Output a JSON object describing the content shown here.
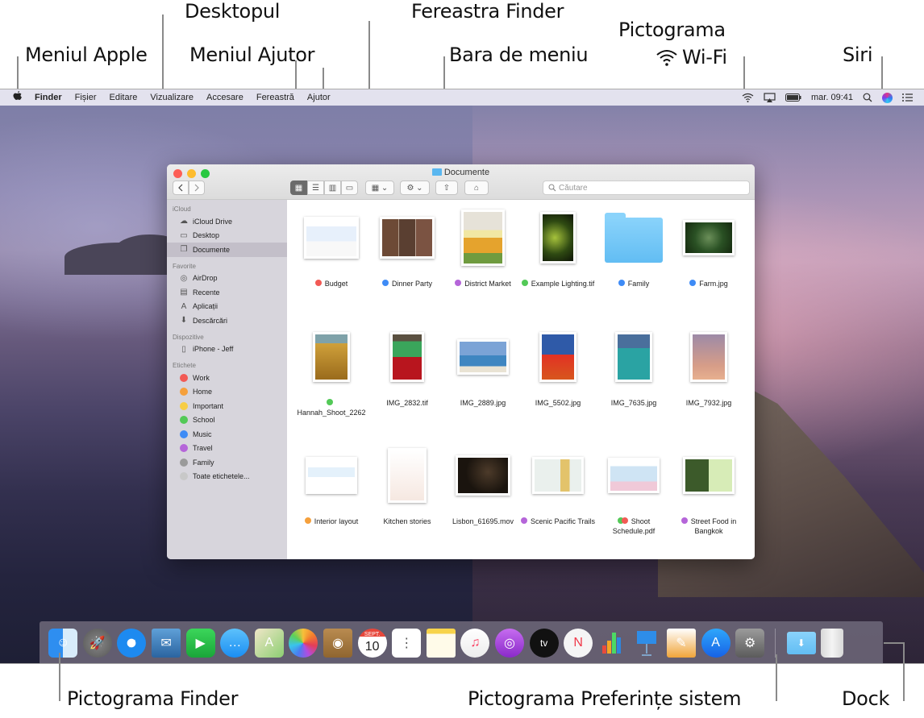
{
  "callouts": {
    "apple_menu": "Meniul Apple",
    "desktop": "Desktopul",
    "help_menu": "Meniul Ajutor",
    "finder_window": "Fereastra Finder",
    "menu_bar": "Bara de meniu",
    "wifi_icon_line1": "Pictograma",
    "wifi_icon_line2": "Wi-Fi",
    "siri": "Siri",
    "finder_icon": "Pictograma Finder",
    "system_prefs_icon": "Pictograma Preferințe sistem",
    "dock": "Dock"
  },
  "menubar": {
    "apple": "",
    "items": [
      "Finder",
      "Fișier",
      "Editare",
      "Vizualizare",
      "Accesare",
      "Fereastră",
      "Ajutor"
    ],
    "clock": "mar. 09:41"
  },
  "finder": {
    "title": "Documente",
    "search_placeholder": "Căutare",
    "sidebar": {
      "sections": [
        {
          "header": "iCloud",
          "items": [
            {
              "label": "iCloud Drive",
              "icon": "cloud-icon"
            },
            {
              "label": "Desktop",
              "icon": "desktop-icon"
            },
            {
              "label": "Documente",
              "icon": "documents-icon",
              "selected": true
            }
          ]
        },
        {
          "header": "Favorite",
          "items": [
            {
              "label": "AirDrop",
              "icon": "airdrop-icon"
            },
            {
              "label": "Recente",
              "icon": "recents-icon"
            },
            {
              "label": "Aplicații",
              "icon": "applications-icon"
            },
            {
              "label": "Descărcări",
              "icon": "downloads-icon"
            }
          ]
        },
        {
          "header": "Dispozitive",
          "items": [
            {
              "label": "iPhone - Jeff",
              "icon": "iphone-icon"
            }
          ]
        },
        {
          "header": "Etichete",
          "items": [
            {
              "label": "Work",
              "color": "#f25a55"
            },
            {
              "label": "Home",
              "color": "#f5a03c"
            },
            {
              "label": "Important",
              "color": "#f7cd45"
            },
            {
              "label": "School",
              "color": "#53c957"
            },
            {
              "label": "Music",
              "color": "#3e8bf6"
            },
            {
              "label": "Travel",
              "color": "#b565d9"
            },
            {
              "label": "Family",
              "color": "#9a9a9a"
            },
            {
              "label": "Toate etichetele...",
              "color": "#c8c8c8"
            }
          ]
        }
      ]
    },
    "files": [
      {
        "name": "Budget",
        "tags": [
          "#f25a55"
        ]
      },
      {
        "name": "Dinner Party",
        "tags": [
          "#3e8bf6"
        ]
      },
      {
        "name": "District Market",
        "tags": [
          "#b565d9"
        ]
      },
      {
        "name": "Example Lighting.tif",
        "tags": [
          "#53c957"
        ]
      },
      {
        "name": "Family",
        "tags": [
          "#3e8bf6"
        ]
      },
      {
        "name": "Farm.jpg",
        "tags": [
          "#3e8bf6"
        ]
      },
      {
        "name": "Hannah_Shoot_2262",
        "tags": [
          "#53c957"
        ]
      },
      {
        "name": "IMG_2832.tif",
        "tags": []
      },
      {
        "name": "IMG_2889.jpg",
        "tags": []
      },
      {
        "name": "IMG_5502.jpg",
        "tags": []
      },
      {
        "name": "IMG_7635.jpg",
        "tags": []
      },
      {
        "name": "IMG_7932.jpg",
        "tags": []
      },
      {
        "name": "Interior layout",
        "tags": [
          "#f5a03c"
        ]
      },
      {
        "name": "Kitchen stories",
        "tags": []
      },
      {
        "name": "Lisbon_61695.mov",
        "tags": []
      },
      {
        "name": "Scenic Pacific Trails",
        "tags": [
          "#b565d9"
        ]
      },
      {
        "name": "Shoot Schedule.pdf",
        "tags": [
          "#53c957",
          "#f25a55"
        ]
      },
      {
        "name": "Street Food in Bangkok",
        "tags": [
          "#b565d9"
        ]
      }
    ]
  },
  "dock": {
    "apps": [
      "Finder",
      "Launchpad",
      "Safari",
      "Mail",
      "FaceTime",
      "Messages",
      "Maps",
      "Photos",
      "Contacts",
      "Calendar",
      "Reminders",
      "Notes",
      "Music",
      "Podcasts",
      "TV",
      "News",
      "Numbers",
      "Keynote",
      "Pages",
      "App Store",
      "System Preferences"
    ],
    "calendar_month": "SEPT.",
    "calendar_day": "10",
    "tv_label": "tv",
    "extras": [
      "Downloads",
      "Trash"
    ]
  }
}
